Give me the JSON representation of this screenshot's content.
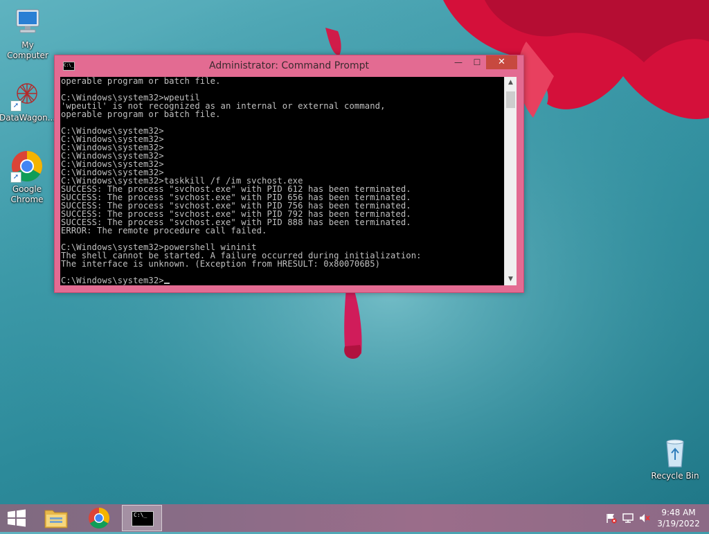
{
  "desktop": {
    "icons": [
      {
        "label": "My Computer",
        "icon": "computer-icon"
      },
      {
        "label": "DataWagon...",
        "icon": "datawagon-icon"
      },
      {
        "label": "Google Chrome",
        "icon": "chrome-icon"
      },
      {
        "label": "Recycle Bin",
        "icon": "recycle-bin-icon"
      }
    ]
  },
  "window": {
    "title": "Administrator: Command Prompt",
    "icon_text": "C:\\_",
    "buttons": {
      "minimize": "—",
      "maximize": "☐",
      "close": "✕"
    },
    "console_lines": [
      "operable program or batch file.",
      "",
      "C:\\Windows\\system32>wpeutil",
      "'wpeutil' is not recognized as an internal or external command,",
      "operable program or batch file.",
      "",
      "C:\\Windows\\system32>",
      "C:\\Windows\\system32>",
      "C:\\Windows\\system32>",
      "C:\\Windows\\system32>",
      "C:\\Windows\\system32>",
      "C:\\Windows\\system32>",
      "C:\\Windows\\system32>taskkill /f /im svchost.exe",
      "SUCCESS: The process \"svchost.exe\" with PID 612 has been terminated.",
      "SUCCESS: The process \"svchost.exe\" with PID 656 has been terminated.",
      "SUCCESS: The process \"svchost.exe\" with PID 756 has been terminated.",
      "SUCCESS: The process \"svchost.exe\" with PID 792 has been terminated.",
      "SUCCESS: The process \"svchost.exe\" with PID 888 has been terminated.",
      "ERROR: The remote procedure call failed.",
      "",
      "C:\\Windows\\system32>powershell wininit",
      "The shell cannot be started. A failure occurred during initialization:",
      "The interface is unknown. (Exception from HRESULT: 0x800706B5)",
      "",
      "C:\\Windows\\system32>"
    ]
  },
  "taskbar": {
    "items": [
      {
        "name": "start",
        "icon": "windows-logo-icon"
      },
      {
        "name": "file-explorer",
        "icon": "folder-icon"
      },
      {
        "name": "chrome",
        "icon": "chrome-icon"
      },
      {
        "name": "command-prompt",
        "icon": "cmd-icon",
        "icon_text": "C:\\_",
        "active": true
      }
    ],
    "tray": [
      "action-center-flag-icon",
      "network-icon",
      "volume-muted-icon"
    ],
    "clock": {
      "time": "9:48 AM",
      "date": "3/19/2022"
    }
  },
  "colors": {
    "window_frame": "#e36b92",
    "close_button": "#c7493f",
    "console_bg": "#000000",
    "console_fg": "#c0c0c0",
    "taskbar": "#8a6c87"
  }
}
